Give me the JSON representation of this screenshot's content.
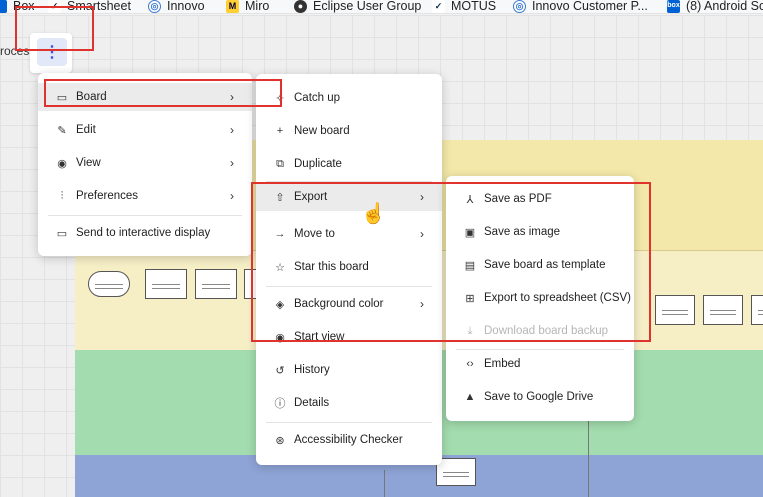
{
  "bookmarks": [
    {
      "label": "Box",
      "icon": "box-icon"
    },
    {
      "label": "Smartsheet",
      "icon": "smartsheet-icon"
    },
    {
      "label": "Innovo",
      "icon": "globe-icon"
    },
    {
      "label": "Miro",
      "icon": "miro-icon"
    },
    {
      "label": "Eclipse User Group",
      "icon": "github-icon"
    },
    {
      "label": "MOTUS",
      "icon": "motus-icon"
    },
    {
      "label": "Innovo Customer P...",
      "icon": "globe-icon"
    },
    {
      "label": "(8) Android So",
      "icon": "box-icon"
    }
  ],
  "toolbar": {
    "process_label": "rocess",
    "more_icon": "kebab-icon"
  },
  "main_menu": {
    "items": [
      {
        "label": "Board",
        "icon": "board-icon",
        "has_submenu": true
      },
      {
        "label": "Edit",
        "icon": "pen-icon",
        "has_submenu": true
      },
      {
        "label": "View",
        "icon": "eye-icon",
        "has_submenu": true
      },
      {
        "label": "Preferences",
        "icon": "sliders-icon",
        "has_submenu": true
      },
      {
        "label": "Send to interactive display",
        "icon": "display-icon",
        "has_submenu": false
      }
    ]
  },
  "board_menu": {
    "items": [
      {
        "label": "Catch up",
        "icon": "sparkle-icon"
      },
      {
        "label": "New board",
        "icon": "plus-icon"
      },
      {
        "label": "Duplicate",
        "icon": "duplicate-icon"
      },
      {
        "label": "Export",
        "icon": "export-icon",
        "has_submenu": true
      },
      {
        "label": "Move to",
        "icon": "arrow-right-icon",
        "has_submenu": true
      },
      {
        "label": "Star this board",
        "icon": "star-icon"
      },
      {
        "label": "Background color",
        "icon": "paint-bucket-icon",
        "has_submenu": true
      },
      {
        "label": "Start view",
        "icon": "eye-icon"
      },
      {
        "label": "History",
        "icon": "history-icon"
      },
      {
        "label": "Details",
        "icon": "info-icon"
      },
      {
        "label": "Accessibility Checker",
        "icon": "accessibility-icon"
      }
    ]
  },
  "export_menu": {
    "items": [
      {
        "label": "Save as PDF",
        "icon": "pdf-icon",
        "disabled": false
      },
      {
        "label": "Save as image",
        "icon": "image-icon",
        "disabled": false
      },
      {
        "label": "Save board as template",
        "icon": "template-icon",
        "disabled": false
      },
      {
        "label": "Export to spreadsheet (CSV)",
        "icon": "grid-icon",
        "disabled": false
      },
      {
        "label": "Download board backup",
        "icon": "download-icon",
        "disabled": true
      },
      {
        "label": "Embed",
        "icon": "code-icon",
        "disabled": false
      },
      {
        "label": "Save to Google Drive",
        "icon": "google-drive-icon",
        "disabled": false
      }
    ]
  },
  "colors": {
    "highlight": "#e0332e",
    "accent": "#3a57d6"
  }
}
